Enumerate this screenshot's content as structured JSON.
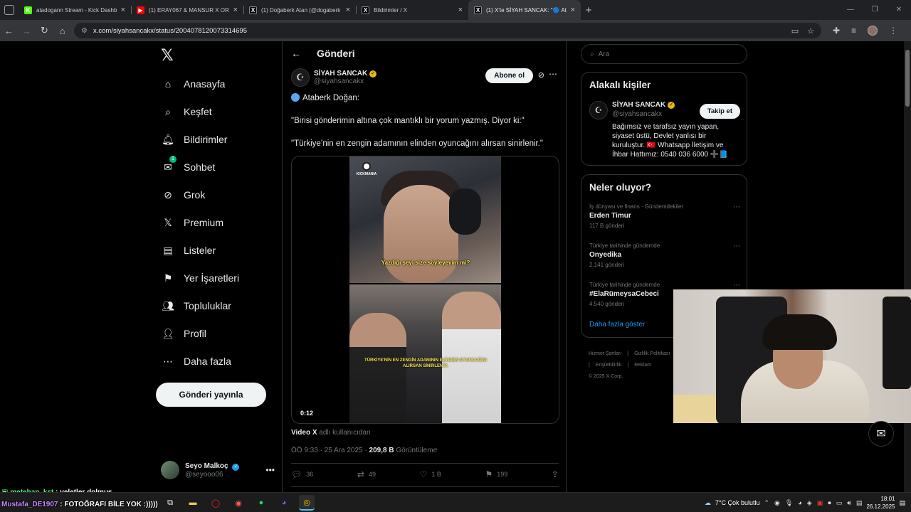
{
  "browser": {
    "tabs": [
      {
        "title": "atadogann Stream - Kick Dashboard",
        "fav": "K",
        "fav_color": "#53fc18",
        "active": false
      },
      {
        "title": "(1) ERAY067 & MANSUR X ORG",
        "fav": "▶",
        "fav_color": "#ff0000",
        "active": false
      },
      {
        "title": "(1) Doğaberk Atan (@dogaberk",
        "fav": "X",
        "fav_color": "#000000",
        "active": false
      },
      {
        "title": "Bildirimler / X",
        "fav": "X",
        "fav_color": "#000000",
        "active": false
      },
      {
        "title": "(1) X'te SİYAH SANCAK: \"🔵 At",
        "fav": "X",
        "fav_color": "#000000",
        "active": true
      }
    ],
    "url": "x.com/siyahsancakx/status/2004078120073314695"
  },
  "nav": {
    "logo": "𝕏",
    "items": [
      {
        "label": "Anasayfa",
        "icon": "home-icon",
        "glyph": "⌂"
      },
      {
        "label": "Keşfet",
        "icon": "search-icon",
        "glyph": "⌕"
      },
      {
        "label": "Bildirimler",
        "icon": "bell-icon",
        "glyph": "🔔︎"
      },
      {
        "label": "Sohbet",
        "icon": "mail-icon",
        "glyph": "✉"
      },
      {
        "label": "Grok",
        "icon": "grok-icon",
        "glyph": "⊘"
      },
      {
        "label": "Premium",
        "icon": "x-premium-icon",
        "glyph": "𝕏"
      },
      {
        "label": "Listeler",
        "icon": "list-icon",
        "glyph": "▤"
      },
      {
        "label": "Yer İşaretleri",
        "icon": "bookmark-icon",
        "glyph": "⚑"
      },
      {
        "label": "Topluluklar",
        "icon": "communities-icon",
        "glyph": "👥︎"
      },
      {
        "label": "Profil",
        "icon": "profile-icon",
        "glyph": "👤︎"
      },
      {
        "label": "Daha fazla",
        "icon": "more-circle-icon",
        "glyph": "⋯"
      }
    ],
    "sohbet_badge": "1",
    "post_button": "Gönderi yayınla",
    "me": {
      "name": "Seyo Malkoç",
      "handle": "@seyooo06"
    }
  },
  "main": {
    "header": "Gönderi",
    "author": {
      "name": "SİYAH SANCAK",
      "handle": "@siyahsancakx"
    },
    "subscribe": "Abone ol",
    "text": {
      "p1": "Ataberk Doğan:",
      "p2": "\"Birisi gönderimin altına çok mantıklı bir yorum yazmış. Diyor ki:\"",
      "p3": "\"Türkiye’nin en zengin adamının elinden oyuncağını alırsan sinirlenir.\""
    },
    "video": {
      "brand": "KICKMANIA",
      "caption_top": "Yazdığı şeyi size söyleyeyim mi?",
      "caption_bottom": "TÜRKİYE'NİN EN ZENGİN ADAMININ ELİNDEN OYUNCAĞINI ALIRSAN SİNİRLENİR.",
      "time": "0:12"
    },
    "source": {
      "by": "Video X",
      "rest": "adlı kullanıcıdan"
    },
    "meta": {
      "time": "ÖÖ 9:33 · 25 Ara 2025 · ",
      "views": "209,8 B",
      "views_label": "Görüntüleme"
    },
    "actions": {
      "replies": "36",
      "reposts": "49",
      "likes": "1 B",
      "bookmarks": "199"
    }
  },
  "right": {
    "search_placeholder": "Ara",
    "related": {
      "title": "Alakalı kişiler",
      "name": "SİYAH SANCAK",
      "handle": "@siyahsancakx",
      "follow": "Takip et",
      "bio": "Bağımsız ve tarafsız yayın yapan, siyaset üstü, Devlet yanlısı bir kuruluştur. 🇹🇷 Whatsapp İletişim ve İhbar Hattımız: 0540 036 6000 ➕📘"
    },
    "trends": {
      "title": "Neler oluyor?",
      "items": [
        {
          "context": "İş dünyası ve finans · Gündemdekiler",
          "topic": "Erden Timur",
          "count": "117 B gönderi"
        },
        {
          "context": "Türkiye tarihinde gündemde",
          "topic": "Onyedika",
          "count": "2.141 gönderi"
        },
        {
          "context": "Türkiye tarihinde gündemde",
          "topic": "#ElaRümeysaCebeci",
          "count": "4.540 gönderi"
        }
      ],
      "show_more": "Daha fazla göster"
    },
    "footer": {
      "links": [
        "Hizmet Şartları",
        "|",
        "Gizlilik Politikası",
        "Imprint",
        "|",
        "Erişilebilirlik",
        "|",
        "Reklam"
      ],
      "copyright": "© 2025 X Corp."
    }
  },
  "overlay": {
    "chat1_user": "metehan_kst",
    "chat1_msg": " : veletler dolmuş",
    "chat2_user": "Mustafa_DE1907",
    "chat2_msg": " : FOTOĞRAFI BİLE YOK :)))))"
  },
  "taskbar": {
    "weather": "7°C  Çok bulutlu",
    "time": "18:01",
    "date": "26.12.2025"
  }
}
